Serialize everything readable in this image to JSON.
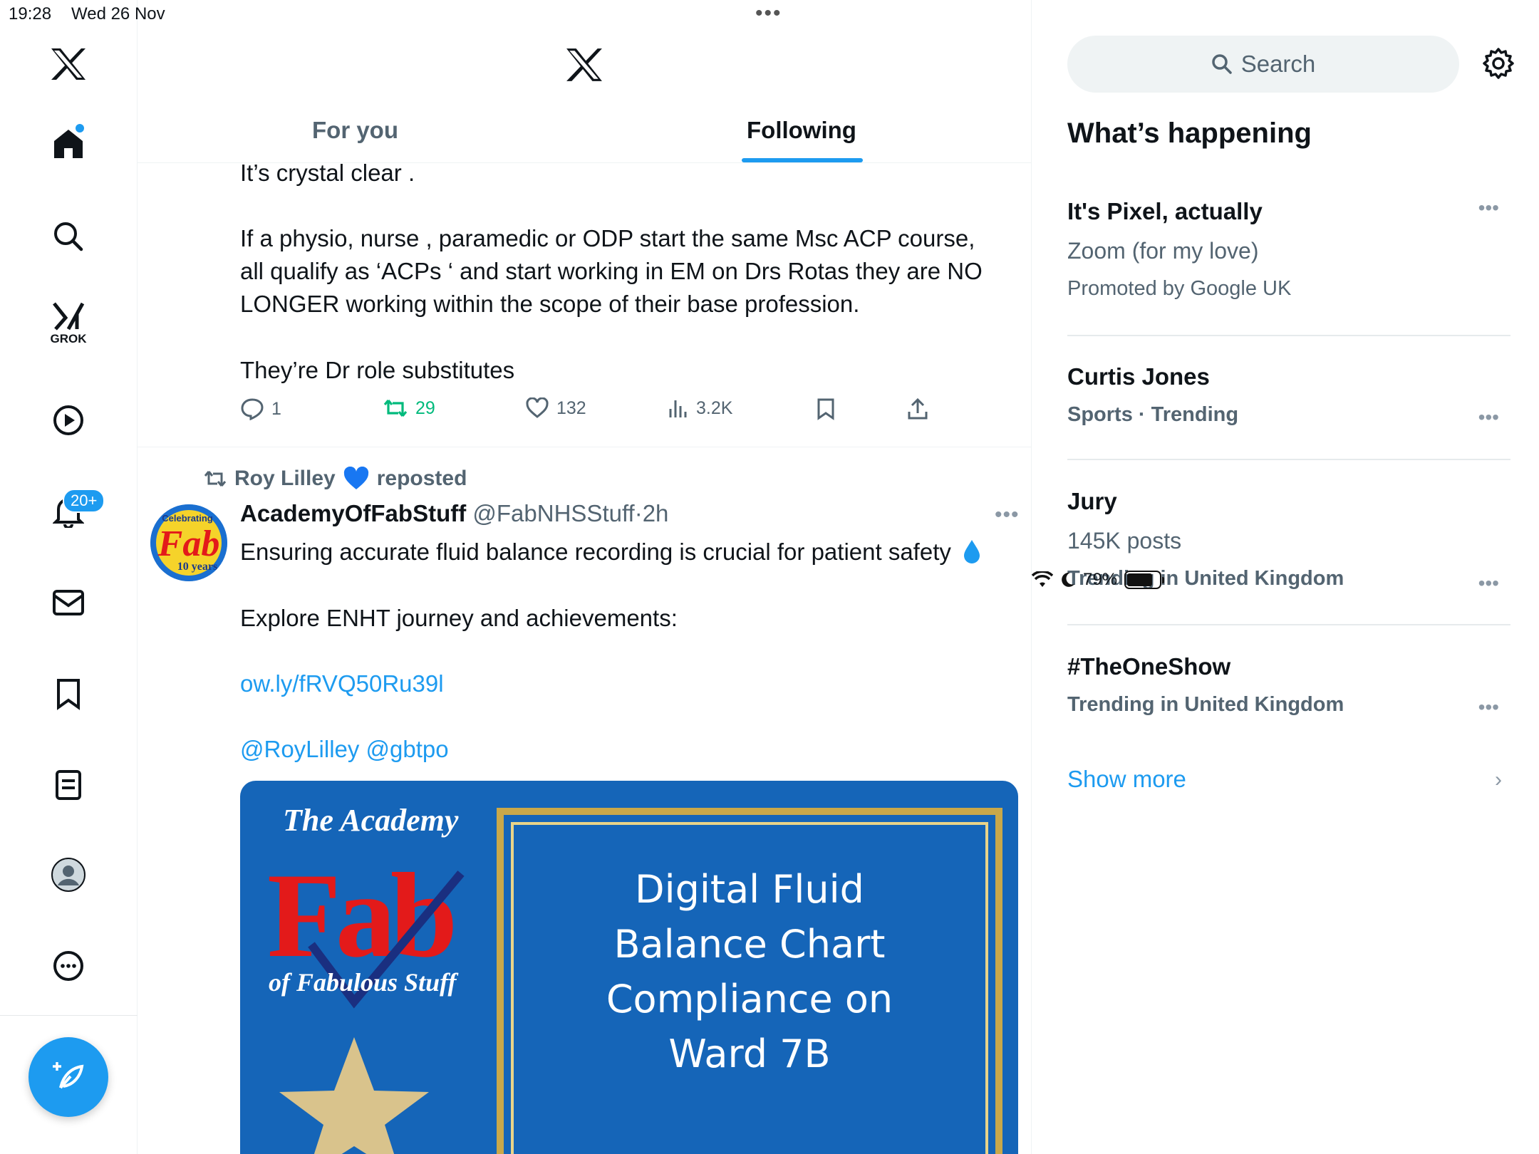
{
  "status_bar": {
    "time": "19:28",
    "date": "Wed 26 Nov",
    "battery": "79%",
    "battery_level": 0.79
  },
  "nav": {
    "notifications_badge": "20+",
    "grok_label": "GROK"
  },
  "header": {
    "tabs": [
      {
        "label": "For you",
        "active": false
      },
      {
        "label": "Following",
        "active": true
      }
    ]
  },
  "tweet1": {
    "lines": [
      "It’s crystal clear .",
      "If a physio, nurse , paramedic or ODP start the same Msc ACP course,",
      "all qualify as ‘ACPs  ‘ and start working in EM on Drs Rotas they are NO",
      "LONGER working within the scope of their base profession.",
      "They’re Dr role substitutes"
    ],
    "actions": {
      "replies": "1",
      "reposts": "29",
      "likes": "132",
      "views": "3.2K"
    }
  },
  "tweet2": {
    "reposted_by": "Roy Lilley",
    "reposted_label": "reposted",
    "author_name": "AcademyOfFabStuff",
    "author_handle": "@FabNHSStuff",
    "time": "2h",
    "text_line1": "Ensuring accurate fluid balance recording is crucial for patient safety",
    "text_line2": "Explore ENHT journey and achievements:",
    "link": "ow.ly/fRVQ50Ru39l",
    "mentions": "@RoyLilley @gbtpo",
    "avatar_text": {
      "top": "Celebrating",
      "main": "Fab",
      "bottom": "10 years"
    },
    "media": {
      "academy_title": "The Academy",
      "fab_word": "Fab",
      "fab_sub": "of Fabulous Stuff",
      "chart_title_lines": [
        "Digital Fluid",
        "Balance Chart",
        "Compliance on",
        "Ward 7B"
      ]
    }
  },
  "sidebar": {
    "search_placeholder": "Search",
    "section_title": "What’s happening",
    "trends": [
      {
        "title": "It's Pixel, actually",
        "sub": "Zoom (for my love)",
        "meta": "Promoted by Google UK"
      },
      {
        "title": "Curtis Jones",
        "sub": "Sports · Trending"
      },
      {
        "title": "Jury",
        "sub": "145K posts",
        "meta": "Trending in United Kingdom"
      },
      {
        "title": "#TheOneShow",
        "sub": "Trending in United Kingdom"
      }
    ],
    "show_more": "Show more"
  },
  "colors": {
    "accent": "#1d9bf0",
    "repost_green": "#00ba7c",
    "muted": "#536471"
  }
}
